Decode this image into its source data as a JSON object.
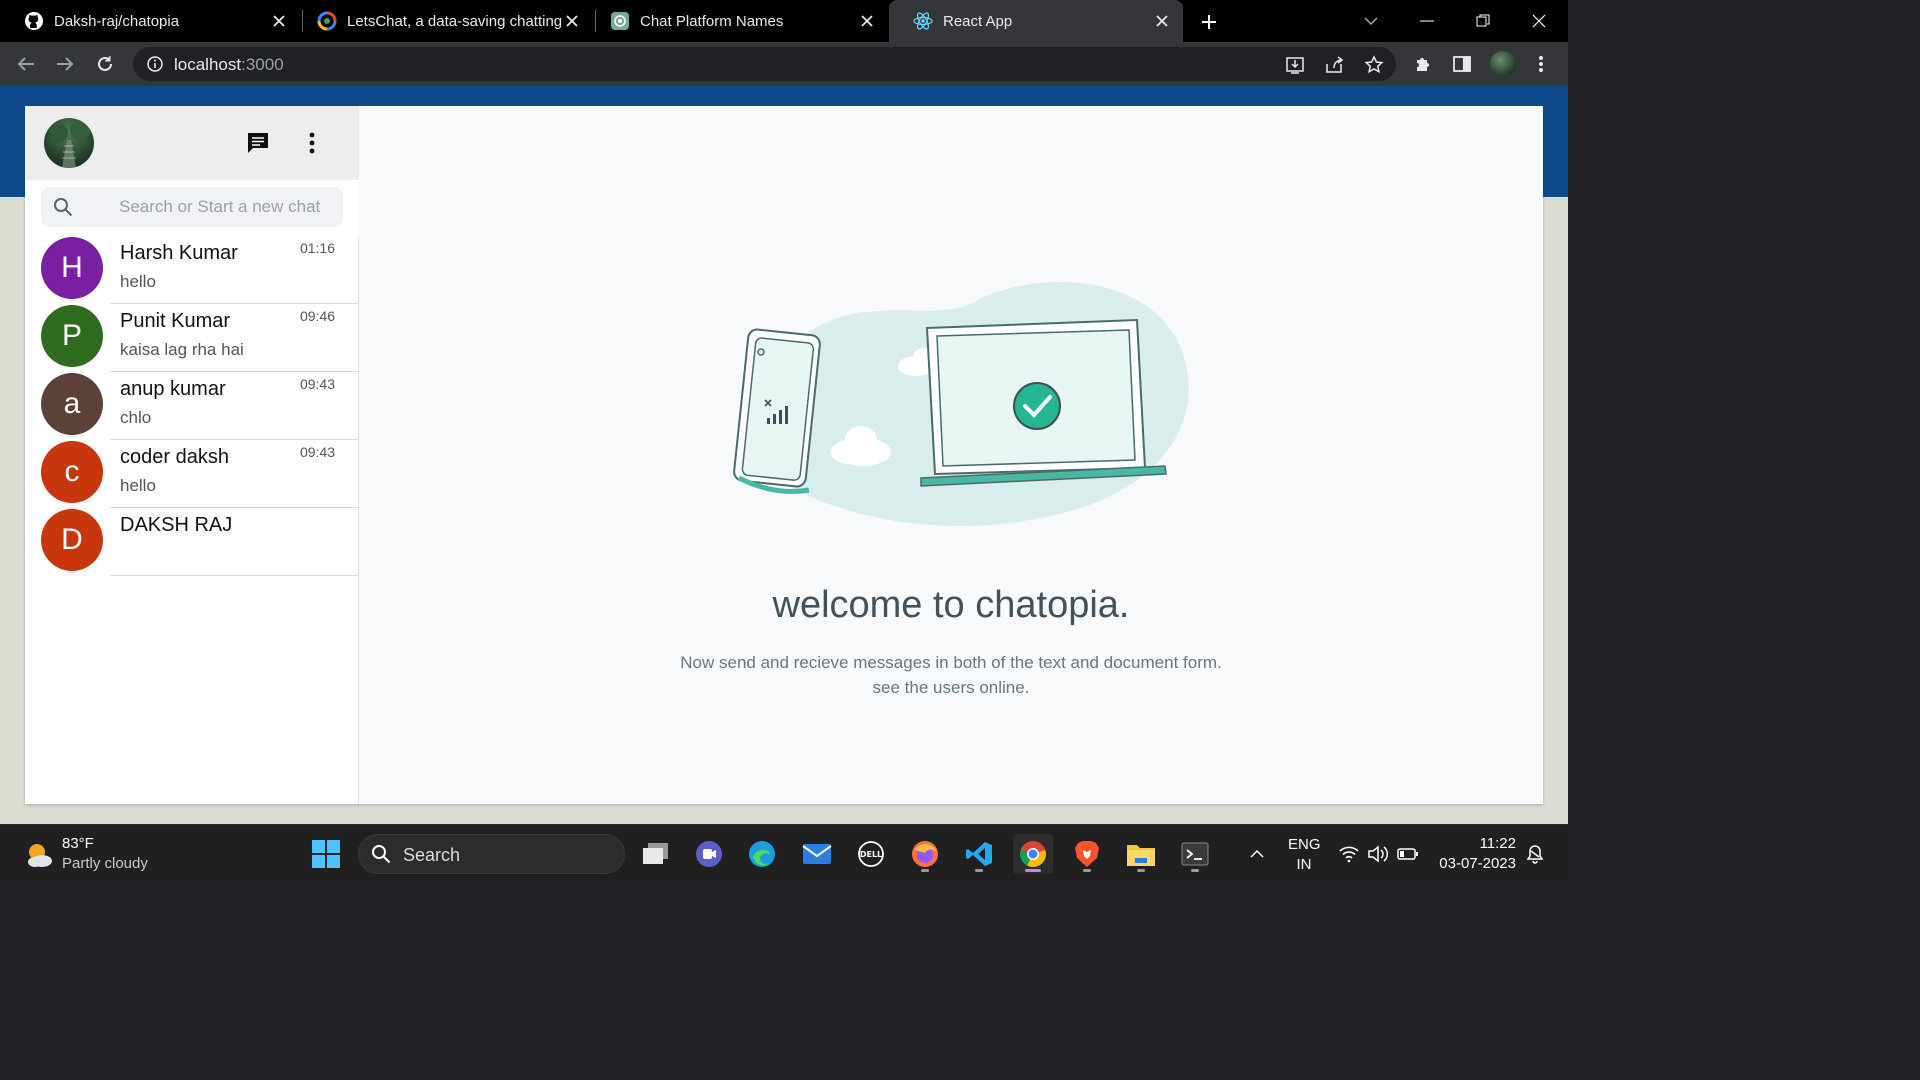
{
  "browser": {
    "tabs": [
      {
        "title": "Daksh-raj/chatopia",
        "favicon": "github-icon"
      },
      {
        "title": "LetsChat, a data-saving chatting",
        "favicon": "google-search-icon"
      },
      {
        "title": "Chat Platform Names",
        "favicon": "chatgpt-icon"
      },
      {
        "title": "React App",
        "favicon": "react-icon",
        "active": true
      }
    ],
    "url_host": "localhost",
    "url_port": ":3000"
  },
  "sidebar": {
    "search_placeholder": "Search or Start a new chat",
    "chats": [
      {
        "initial": "H",
        "name": "Harsh Kumar",
        "time": "01:16",
        "last": "hello",
        "color": "#7b1fa2"
      },
      {
        "initial": "P",
        "name": "Punit Kumar",
        "time": "09:46",
        "last": "kaisa lag rha hai",
        "color": "#2e6b1f"
      },
      {
        "initial": "a",
        "name": "anup kumar",
        "time": "09:43",
        "last": "chlo",
        "color": "#5d4037"
      },
      {
        "initial": "c",
        "name": "coder daksh",
        "time": "09:43",
        "last": "hello",
        "color": "#c8360d"
      },
      {
        "initial": "D",
        "name": "DAKSH RAJ",
        "time": "",
        "last": "",
        "color": "#c8360d"
      }
    ]
  },
  "main": {
    "title": "welcome to chatopia.",
    "subtitle_line1": "Now send and recieve messages in both of the text and document form.",
    "subtitle_line2": "see the users online."
  },
  "taskbar": {
    "temperature": "83°F",
    "weather": "Partly cloudy",
    "search_label": "Search",
    "lang_top": "ENG",
    "lang_bottom": "IN",
    "time": "11:22",
    "date": "03-07-2023"
  },
  "colors": {
    "accent_teal": "#25d366",
    "header_band": "#0f4a8a"
  }
}
